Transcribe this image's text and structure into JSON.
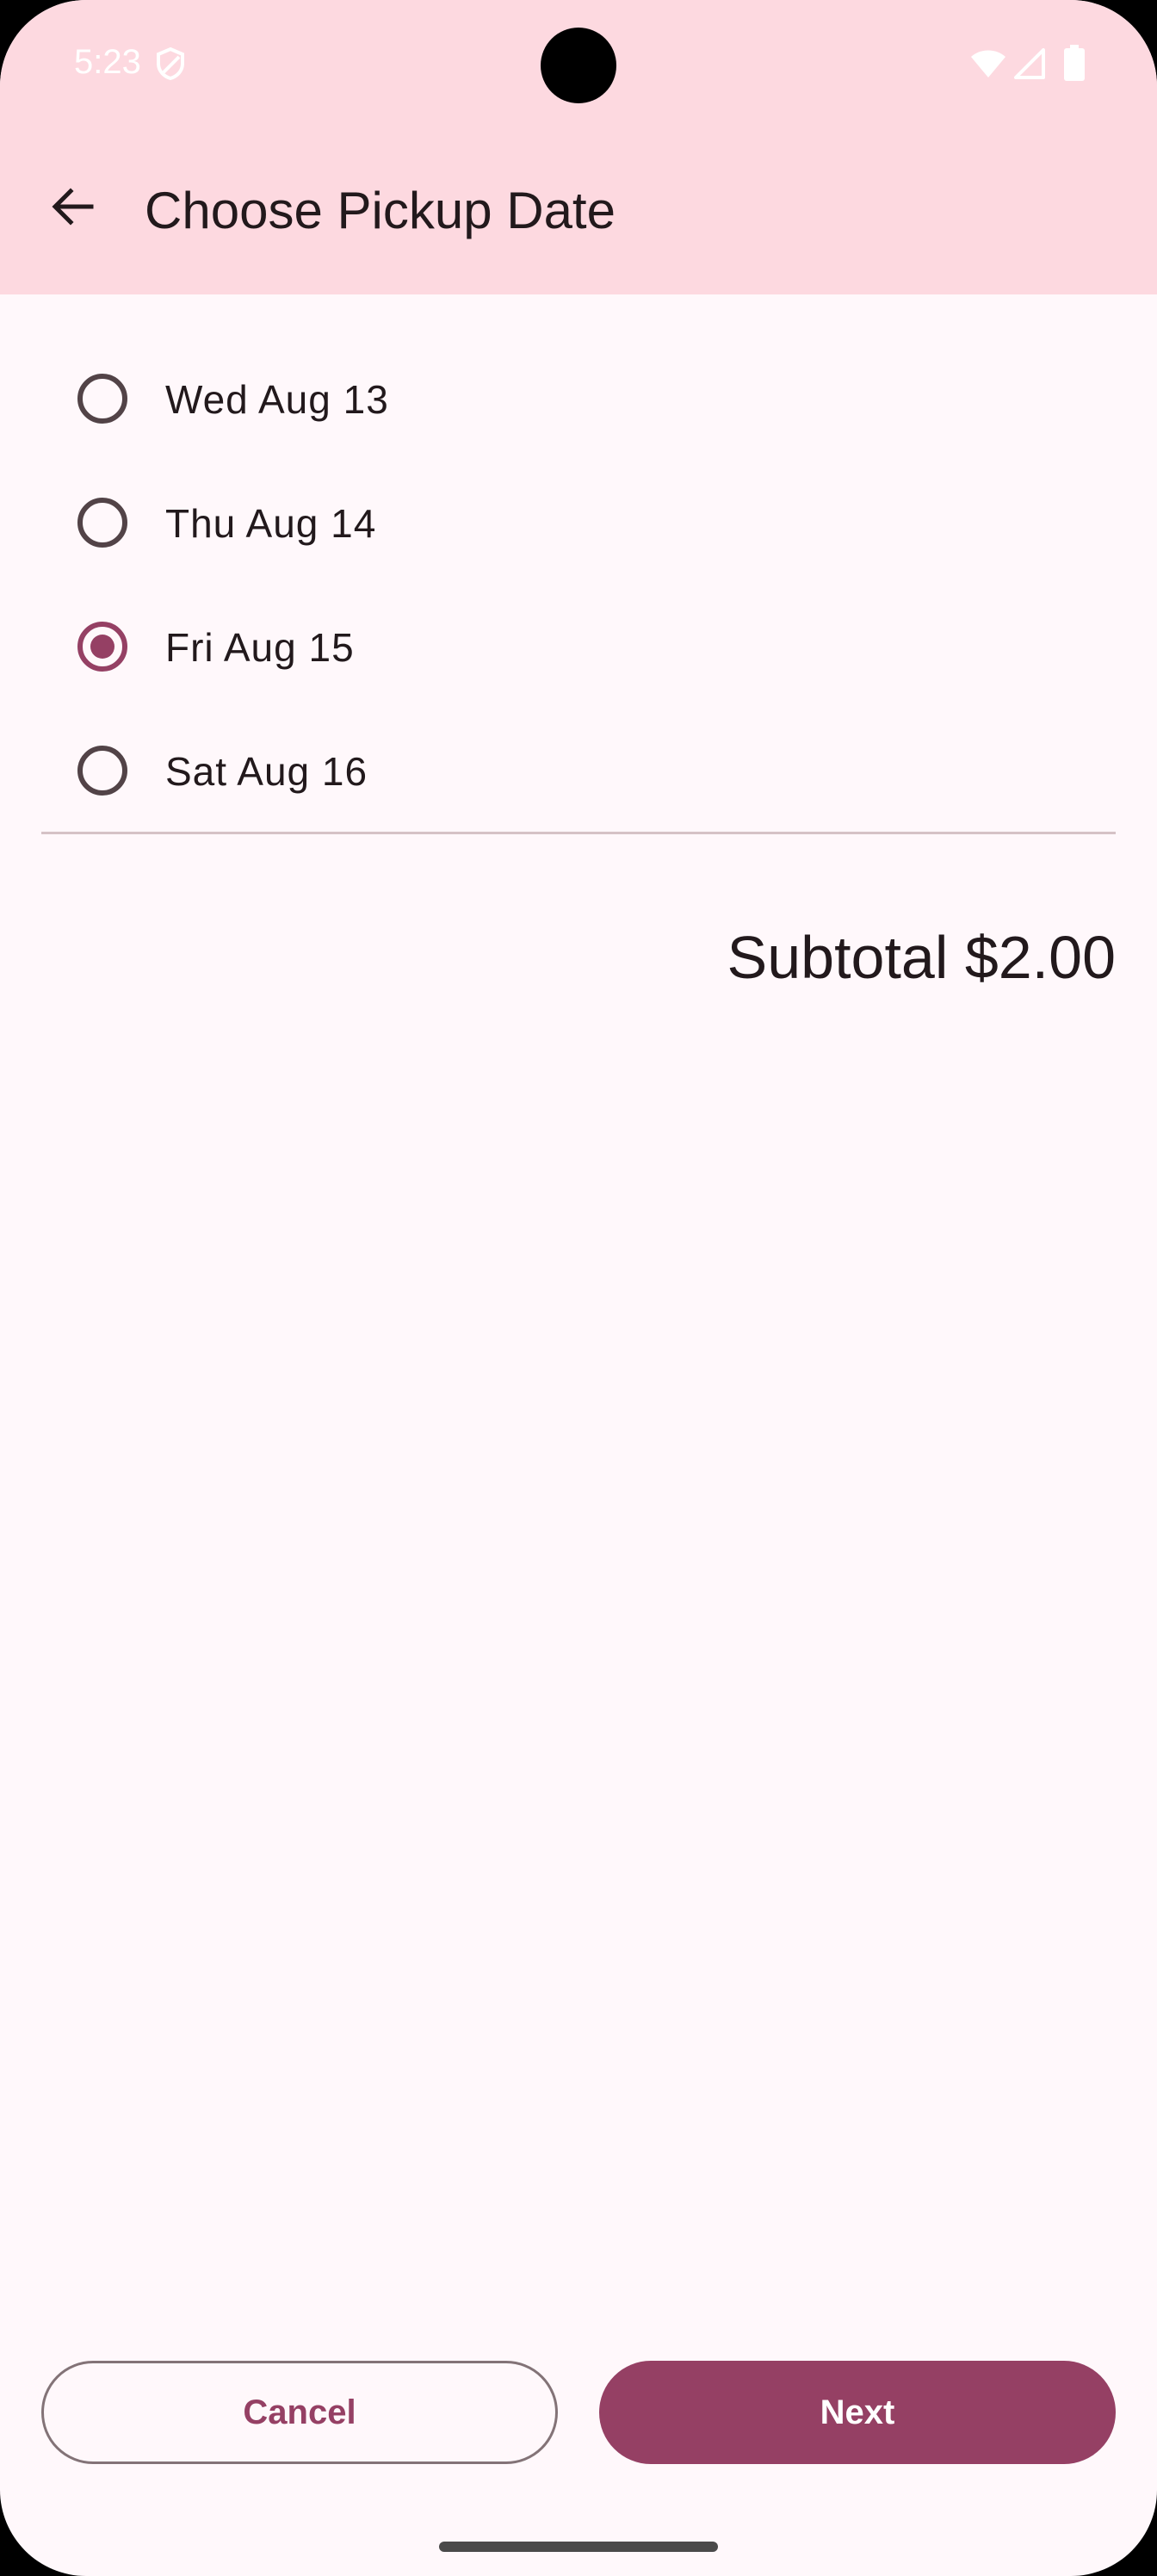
{
  "status_bar": {
    "time": "5:23",
    "icons": [
      "shield-icon",
      "wifi-icon",
      "signal-icon",
      "battery-icon"
    ]
  },
  "app_bar": {
    "back_icon": "arrow-back-icon",
    "title": "Choose Pickup Date"
  },
  "date_options": [
    {
      "label": "Wed Aug 13",
      "selected": false
    },
    {
      "label": "Thu Aug 14",
      "selected": false
    },
    {
      "label": "Fri Aug 15",
      "selected": true
    },
    {
      "label": "Sat Aug 16",
      "selected": false
    }
  ],
  "summary": {
    "subtotal": "Subtotal $2.00"
  },
  "actions": {
    "cancel_label": "Cancel",
    "next_label": "Next"
  },
  "colors": {
    "primary": "#954064",
    "top_bar": "#fdd9e0",
    "background": "#fff8fb",
    "text": "#22191c"
  }
}
